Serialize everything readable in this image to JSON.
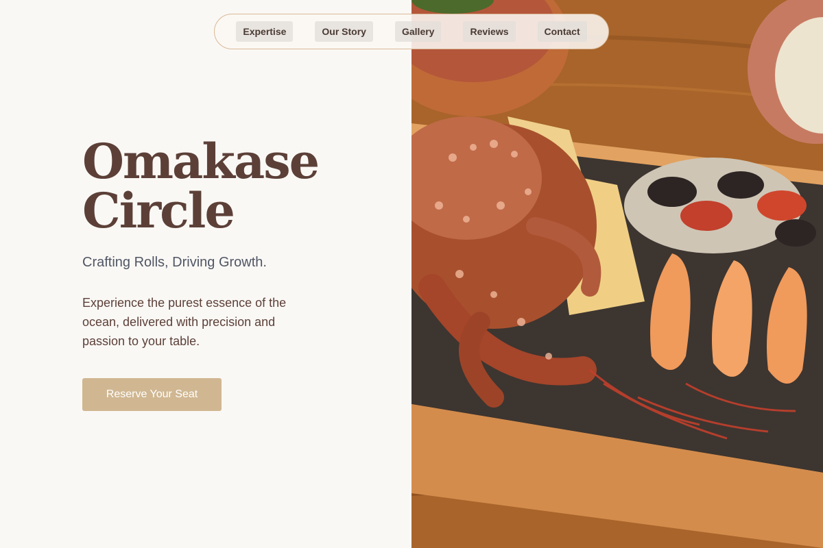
{
  "nav": {
    "items": [
      {
        "label": "Expertise"
      },
      {
        "label": "Our Story"
      },
      {
        "label": "Gallery"
      },
      {
        "label": "Reviews"
      },
      {
        "label": "Contact"
      }
    ]
  },
  "hero": {
    "title_line1": "Omakase",
    "title_line2": "Circle",
    "tagline": "Crafting Rolls, Driving Growth.",
    "description": "Experience the purest essence of the ocean, delivered with precision and passion to your table.",
    "cta_label": "Reserve Your Seat"
  },
  "colors": {
    "background": "#faf8f5",
    "title": "#5c4038",
    "tagline": "#4f5663",
    "cta": "#d0b792",
    "nav_border": "#d9b896"
  }
}
